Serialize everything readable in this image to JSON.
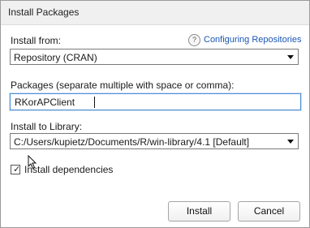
{
  "window": {
    "title": "Install Packages"
  },
  "install_from": {
    "label": "Install from:",
    "help_glyph": "?",
    "help_link": "Configuring Repositories",
    "selected": "Repository (CRAN)"
  },
  "packages": {
    "label": "Packages (separate multiple with space or comma):",
    "value": "RKorAPClient"
  },
  "library": {
    "label": "Install to Library:",
    "selected": "C:/Users/kupietz/Documents/R/win-library/4.1 [Default]"
  },
  "dependencies": {
    "label": "Install dependencies",
    "checked": true
  },
  "buttons": {
    "install": "Install",
    "cancel": "Cancel"
  },
  "icons": {
    "help": "help-icon",
    "checkbox": "check-icon",
    "cursor": "mouse-pointer-icon"
  }
}
